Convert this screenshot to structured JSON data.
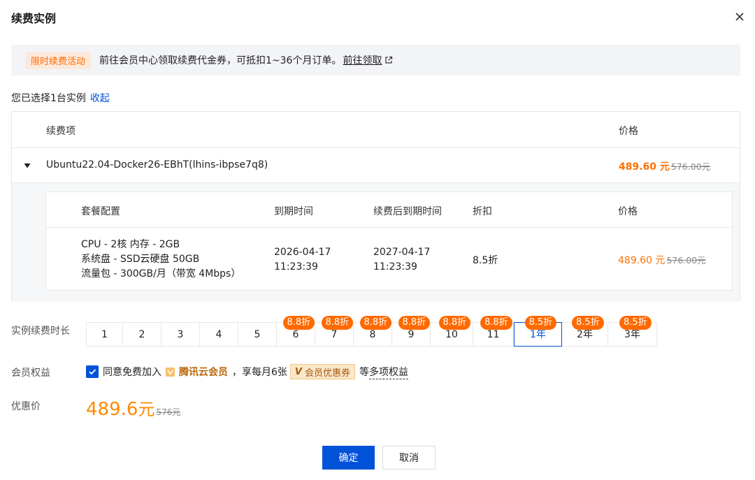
{
  "dialog": {
    "title": "续费实例"
  },
  "promo": {
    "tag": "限时续费活动",
    "text": "前往会员中心领取续费代金券，可抵扣1~36个月订单。",
    "link": "前往领取"
  },
  "selection": {
    "text": "您已选择1台实例",
    "collapse": "收起"
  },
  "outer_table": {
    "col_item": "续费项",
    "col_price": "价格",
    "row": {
      "name": "Ubuntu22.04-Docker26-EBhT(lhins-ibpse7q8)",
      "price": "489.60 元",
      "original_price": "576.00元"
    }
  },
  "inner_table": {
    "headers": {
      "config": "套餐配置",
      "expire": "到期时间",
      "renew_expire": "续费后到期时间",
      "discount": "折扣",
      "price": "价格"
    },
    "row": {
      "config_lines": [
        "CPU - 2核 内存 - 2GB",
        "系统盘 - SSD云硬盘 50GB",
        "流量包 - 300GB/月（带宽 4Mbps）"
      ],
      "expire_date": "2026-04-17",
      "expire_time": "11:23:39",
      "renew_date": "2027-04-17",
      "renew_time": "11:23:39",
      "discount": "8.5折",
      "price": "489.60 元",
      "original_price": "576.00元"
    }
  },
  "duration": {
    "label": "实例续费时长",
    "options": [
      {
        "label": "1",
        "badge": ""
      },
      {
        "label": "2",
        "badge": ""
      },
      {
        "label": "3",
        "badge": ""
      },
      {
        "label": "4",
        "badge": ""
      },
      {
        "label": "5",
        "badge": ""
      },
      {
        "label": "6",
        "badge": "8.8折"
      },
      {
        "label": "7",
        "badge": "8.8折"
      },
      {
        "label": "8",
        "badge": "8.8折"
      },
      {
        "label": "9",
        "badge": "8.8折"
      },
      {
        "label": "10",
        "badge": "8.8折"
      },
      {
        "label": "11",
        "badge": "8.8折"
      },
      {
        "label": "1年",
        "badge": "8.5折"
      },
      {
        "label": "2年",
        "badge": "8.5折"
      },
      {
        "label": "3年",
        "badge": "8.5折"
      }
    ],
    "selected": "1年"
  },
  "member": {
    "label": "会员权益",
    "checked": true,
    "text1": "同意免费加入",
    "brand": "腾讯云会员",
    "text2": "，享每月6张",
    "coupon_v": "V",
    "coupon": "会员优惠券",
    "text3": "等",
    "more": "多项权益"
  },
  "final": {
    "label": "优惠价",
    "price": "489.6",
    "unit": "元",
    "original": "576元"
  },
  "buttons": {
    "ok": "确定",
    "cancel": "取消"
  },
  "colors": {
    "primary": "#0052d9",
    "accent": "#ff6a00",
    "price": "#ff7000"
  }
}
